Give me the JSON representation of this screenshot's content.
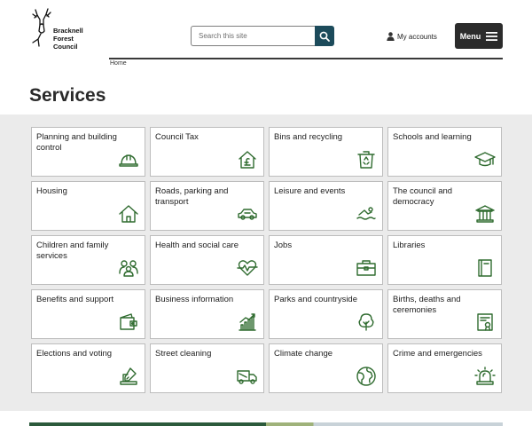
{
  "header": {
    "logo_text": [
      "Bracknell",
      "Forest",
      "Council"
    ],
    "search_placeholder": "Search this site",
    "account_label": "My accounts",
    "menu_label": "Menu"
  },
  "breadcrumb": {
    "home": "Home"
  },
  "page": {
    "title": "Services"
  },
  "colors": {
    "accent_green": "#2f6b2f",
    "search_button": "#1c4b5b",
    "menu_button": "#2b2b2b",
    "grey_band": "#ebebeb"
  },
  "tiles": [
    {
      "label": "Planning and building control",
      "icon": "hard-hat-icon"
    },
    {
      "label": "Council Tax",
      "icon": "house-pound-icon"
    },
    {
      "label": "Bins and recycling",
      "icon": "recycling-bin-icon"
    },
    {
      "label": "Schools and learning",
      "icon": "graduation-cap-icon"
    },
    {
      "label": "Housing",
      "icon": "house-icon"
    },
    {
      "label": "Roads, parking and transport",
      "icon": "car-icon"
    },
    {
      "label": "Leisure and events",
      "icon": "swimmer-icon"
    },
    {
      "label": "The council and democracy",
      "icon": "civic-building-icon"
    },
    {
      "label": "Children and family services",
      "icon": "family-icon"
    },
    {
      "label": "Health and social care",
      "icon": "heartbeat-icon"
    },
    {
      "label": "Jobs",
      "icon": "briefcase-icon"
    },
    {
      "label": "Libraries",
      "icon": "book-icon"
    },
    {
      "label": "Benefits and support",
      "icon": "wallet-icon"
    },
    {
      "label": "Business information",
      "icon": "growth-chart-icon"
    },
    {
      "label": "Parks and countryside",
      "icon": "tree-icon"
    },
    {
      "label": "Births, deaths and ceremonies",
      "icon": "certificate-icon"
    },
    {
      "label": "Elections and voting",
      "icon": "ballot-icon"
    },
    {
      "label": "Street cleaning",
      "icon": "truck-icon"
    },
    {
      "label": "Climate change",
      "icon": "globe-icon"
    },
    {
      "label": "Crime and emergencies",
      "icon": "siren-icon"
    }
  ]
}
